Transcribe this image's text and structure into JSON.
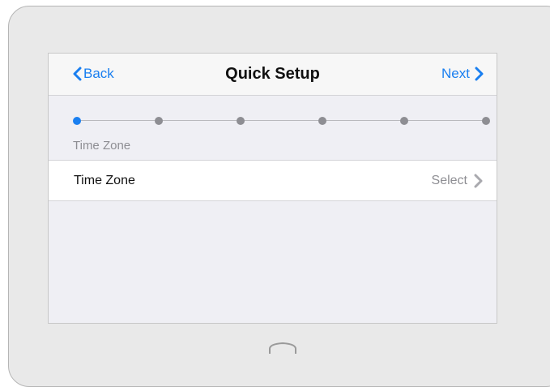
{
  "navbar": {
    "back_label": "Back",
    "title": "Quick Setup",
    "next_label": "Next"
  },
  "progress": {
    "total_steps": 6,
    "current_step": 1,
    "current_step_label": "Time Zone"
  },
  "settings_row": {
    "label": "Time Zone",
    "value": "Select"
  },
  "colors": {
    "accent": "#1a7ff0",
    "inactive_dot": "#8e8e93",
    "secondary_text": "#8e8e93",
    "screen_background": "#efeff4"
  },
  "icons": {
    "back": "chevron-left-icon",
    "next": "chevron-right-icon",
    "row_disclosure": "chevron-right-icon",
    "home": "home-button-icon"
  }
}
